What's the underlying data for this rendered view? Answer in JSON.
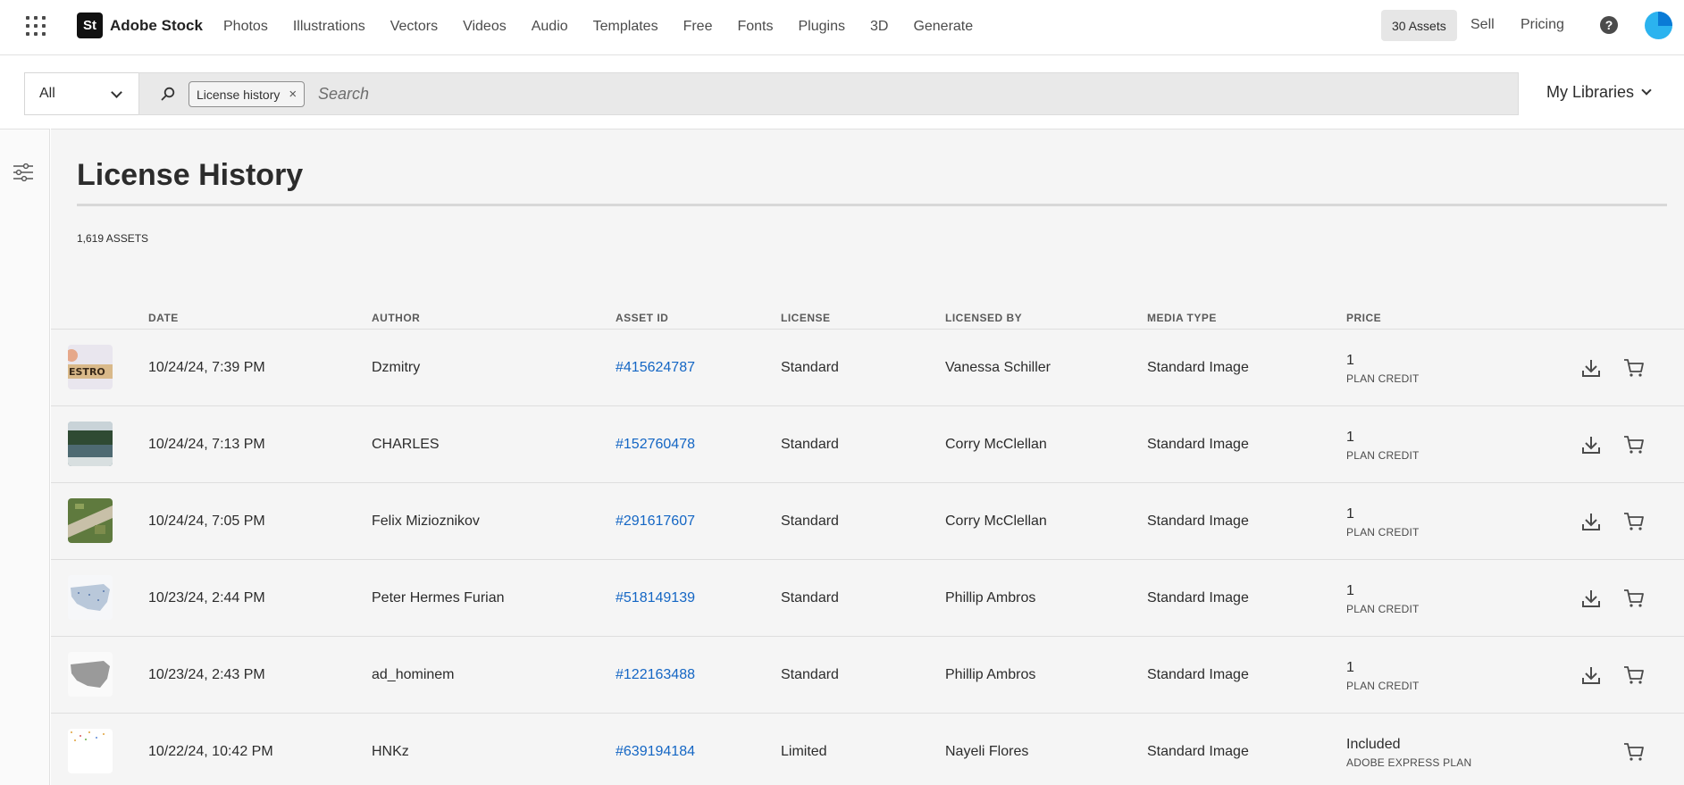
{
  "nav": {
    "brand_logo": "St",
    "brand_name": "Adobe Stock",
    "links": [
      "Photos",
      "Illustrations",
      "Vectors",
      "Videos",
      "Audio",
      "Templates",
      "Free",
      "Fonts",
      "Plugins",
      "3D",
      "Generate"
    ],
    "assets_pill": "30 Assets",
    "sell": "Sell",
    "pricing": "Pricing",
    "help": "?"
  },
  "search": {
    "filter_value": "All",
    "tag": "License history",
    "tag_remove": "×",
    "placeholder": "Search",
    "my_libraries": "My Libraries"
  },
  "page": {
    "title": "License History",
    "count": "1,619 ASSETS"
  },
  "table": {
    "headers": {
      "date": "DATE",
      "author": "AUTHOR",
      "asset_id": "ASSET ID",
      "license": "LICENSE",
      "licensed_by": "LICENSED BY",
      "media_type": "MEDIA TYPE",
      "price": "PRICE"
    },
    "rows": [
      {
        "date": "10/24/24, 7:39 PM",
        "author": "Dzmitry",
        "asset_id": "#415624787",
        "license": "Standard",
        "licensed_by": "Vanessa Schiller",
        "media_type": "Standard Image",
        "price": "1",
        "price_sub": "PLAN CREDIT",
        "thumb": "blocks"
      },
      {
        "date": "10/24/24, 7:13 PM",
        "author": "CHARLES",
        "asset_id": "#152760478",
        "license": "Standard",
        "licensed_by": "Corry McClellan",
        "media_type": "Standard Image",
        "price": "1",
        "price_sub": "PLAN CREDIT",
        "thumb": "lake"
      },
      {
        "date": "10/24/24, 7:05 PM",
        "author": "Felix Mizioznikov",
        "asset_id": "#291617607",
        "license": "Standard",
        "licensed_by": "Corry McClellan",
        "media_type": "Standard Image",
        "price": "1",
        "price_sub": "PLAN CREDIT",
        "thumb": "aerial"
      },
      {
        "date": "10/23/24, 2:44 PM",
        "author": "Peter Hermes Furian",
        "asset_id": "#518149139",
        "license": "Standard",
        "licensed_by": "Phillip Ambros",
        "media_type": "Standard Image",
        "price": "1",
        "price_sub": "PLAN CREDIT",
        "thumb": "map-blue"
      },
      {
        "date": "10/23/24, 2:43 PM",
        "author": "ad_hominem",
        "asset_id": "#122163488",
        "license": "Standard",
        "licensed_by": "Phillip Ambros",
        "media_type": "Standard Image",
        "price": "1",
        "price_sub": "PLAN CREDIT",
        "thumb": "map-gray"
      },
      {
        "date": "10/22/24, 10:42 PM",
        "author": "HNKz",
        "asset_id": "#639194184",
        "license": "Limited",
        "licensed_by": "Nayeli Flores",
        "media_type": "Standard Image",
        "price": "Included",
        "price_sub": "ADOBE EXPRESS PLAN",
        "thumb": "confetti"
      }
    ]
  },
  "colors": {
    "link": "#1466c4",
    "accent_avatar": "#2bb3ef",
    "pill_bg": "#e6e6e6"
  },
  "icons": [
    "app-grid-icon",
    "search-icon",
    "help-icon",
    "filter-sliders-icon",
    "download-icon",
    "cart-icon",
    "chevron-down-icon"
  ]
}
